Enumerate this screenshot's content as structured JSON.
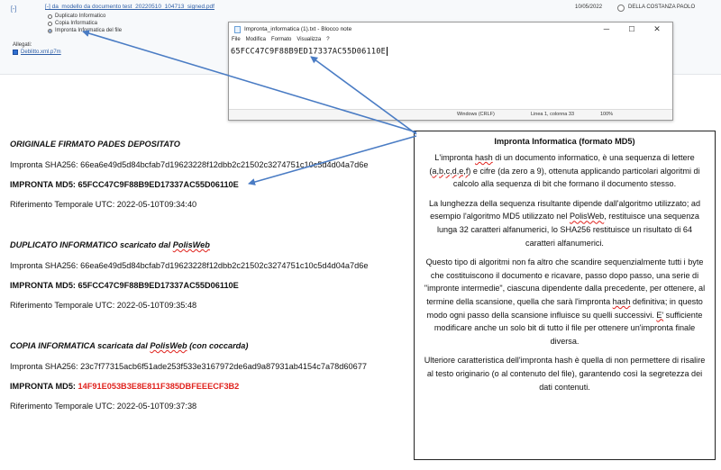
{
  "top_list": {
    "toggle": "[-]",
    "file_name": "[-] da_modello da documento test_20220510_104713_signed.pdf",
    "date": "10/05/2022",
    "author": "DELLA COSTANZA PAOLO",
    "options": [
      "Duplicato Informatico",
      "Copia Informatica",
      "Impronta Informatica del file"
    ],
    "selected_option_index": 2,
    "attachments_label": "Allegati:",
    "attachment_file": "Deblitto.xml.p7m"
  },
  "notepad": {
    "title": "Impronta_informatica (1).txt - Blocco note",
    "menu": [
      "File",
      "Modifica",
      "Formato",
      "Visualizza",
      "?"
    ],
    "content": "65FCC47C9F88B9ED17337AC55D06110E",
    "status_line_ending": "Windows (CRLF)",
    "status_position": "Linea 1, colonna 33",
    "status_zoom": "100%",
    "controls": [
      "─",
      "☐",
      "✕"
    ]
  },
  "sections": [
    {
      "heading_pre": "ORIGINALE FIRMATO PADES DEPOSITATO",
      "heading_spell": "",
      "heading_post": "",
      "sha_label": "Impronta SHA256: ",
      "sha": "66ea6e49d5d84bcfab7d19623228f12dbb2c21502c3274751c10c5d4d04a7d6e",
      "md5_label": "IMPRONTA MD5: ",
      "md5": "65FCC47C9F88B9ED17337AC55D06110E",
      "md5_red": false,
      "utc": "Riferimento Temporale UTC: 2022-05-10T09:34:40"
    },
    {
      "heading_pre": "DUPLICATO INFORMATICO scaricato dal ",
      "heading_spell": "PolisWeb",
      "heading_post": "",
      "sha_label": "Impronta SHA256: ",
      "sha": "66ea6e49d5d84bcfab7d19623228f12dbb2c21502c3274751c10c5d4d04a7d6e",
      "md5_label": "IMPRONTA MD5: ",
      "md5": "65FCC47C9F88B9ED17337AC55D06110E",
      "md5_red": false,
      "utc": "Riferimento Temporale UTC: 2022-05-10T09:35:48"
    },
    {
      "heading_pre": "COPIA INFORMATICA scaricata dal ",
      "heading_spell": "PolisWeb",
      "heading_post": " (con coccarda)",
      "sha_label": "Impronta SHA256: ",
      "sha": "23c7f77315acb6f51ade253f533e3167972de6ad9a87931ab4154c7a78d60677",
      "md5_label": "IMPRONTA MD5: ",
      "md5": "14F91E053B3E8E811F385DBFEEECF3B2",
      "md5_red": true,
      "utc": "Riferimento Temporale UTC: 2022-05-10T09:37:38"
    }
  ],
  "info_box": {
    "title": "Impronta Informatica (formato MD5)",
    "p1_a": "L'impronta ",
    "p1_s1": "hash",
    "p1_b": " di un documento informatico, è una sequenza di lettere (",
    "p1_s2": "a,b,c,d,e,f",
    "p1_c": ") e cifre (da zero a 9), ottenuta applicando particolari algoritmi di calcolo alla sequenza di bit che formano il documento stesso.",
    "p2_a": "La lunghezza della sequenza risultante dipende dall'algoritmo utilizzato; ad esempio l'algoritmo MD5 utilizzato nel ",
    "p2_s1": "PolisWeb",
    "p2_b": ", restituisce una sequenza lunga 32 caratteri alfanumerici, lo SHA256 restituisce un risultato di 64 caratteri alfanumerici.",
    "p3_a": "Questo tipo di algoritmi non fa altro che scandire sequenzialmente tutti i byte che costituiscono il documento e ricavare, passo dopo passo, una serie di \"impronte intermedie\", ciascuna dipendente dalla precedente, per ottenere, al termine della scansione, quella che sarà l'impronta ",
    "p3_s1": "hash",
    "p3_b": " definitiva; in questo modo ogni passo della scansione influisce su quelli successivi. ",
    "p3_s2": "E'",
    "p3_c": " sufficiente modificare anche un solo bit di tutto il file per ottenere un'impronta finale diversa.",
    "p4": "Ulteriore caratteristica dell'impronta hash è quella di non permettere di risalire al testo originario (o al contenuto del file), garantendo così la segretezza dei dati contenuti."
  },
  "colors": {
    "arrow": "#4a7cc4",
    "red": "#e0221d",
    "link": "#2f5fa7"
  }
}
